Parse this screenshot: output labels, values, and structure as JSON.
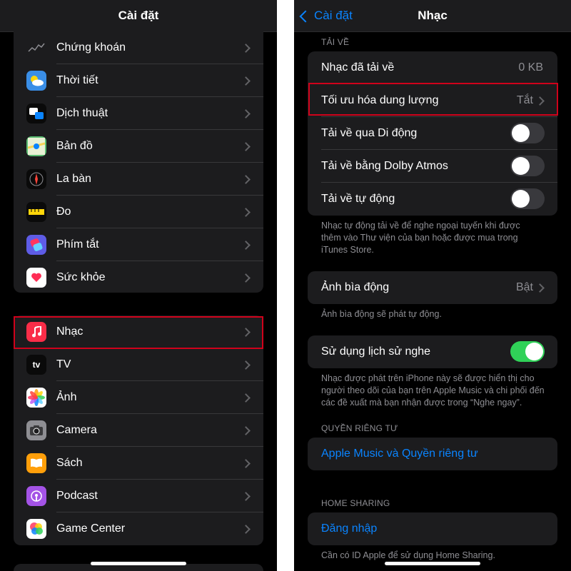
{
  "left": {
    "title": "Cài đặt",
    "group1": [
      {
        "label": "Chứng khoán",
        "icon": "stocks-icon",
        "color": "#1c1c1e"
      },
      {
        "label": "Thời tiết",
        "icon": "weather-icon",
        "color": "#3a8ee6"
      },
      {
        "label": "Dịch thuật",
        "icon": "translate-icon",
        "color": "#0a0a0a"
      },
      {
        "label": "Bản đồ",
        "icon": "maps-icon",
        "color": "#5bbd72"
      },
      {
        "label": "La bàn",
        "icon": "compass-icon",
        "color": "#0a0a0a"
      },
      {
        "label": "Đo",
        "icon": "measure-icon",
        "color": "#0a0a0a"
      },
      {
        "label": "Phím tắt",
        "icon": "shortcuts-icon",
        "color": "#5e5ce6"
      },
      {
        "label": "Sức khỏe",
        "icon": "health-icon",
        "color": "#ffffff"
      }
    ],
    "group2": [
      {
        "label": "Nhạc",
        "icon": "music-icon",
        "color": "#fa2d48"
      },
      {
        "label": "TV",
        "icon": "tv-icon",
        "color": "#0a0a0a",
        "icon_text": "tv"
      },
      {
        "label": "Ảnh",
        "icon": "photos-icon",
        "color": "#ffffff"
      },
      {
        "label": "Camera",
        "icon": "camera-icon",
        "color": "#8e8e93"
      },
      {
        "label": "Sách",
        "icon": "books-icon",
        "color": "#ff9f0a"
      },
      {
        "label": "Podcast",
        "icon": "podcast-icon",
        "color": "#a453e6"
      },
      {
        "label": "Game Center",
        "icon": "game-center-icon",
        "color": "#ffffff"
      }
    ]
  },
  "right": {
    "back_label": "Cài đặt",
    "title": "Nhạc",
    "downloads": {
      "header": "TẢI VỀ",
      "downloaded_label": "Nhạc đã tải về",
      "downloaded_value": "0 KB",
      "optimize_label": "Tối ưu hóa dung lượng",
      "optimize_value": "Tắt",
      "cellular_label": "Tải về qua Di động",
      "cellular_on": false,
      "dolby_label": "Tải về bằng Dolby Atmos",
      "dolby_on": false,
      "auto_label": "Tải về tự động",
      "auto_on": false,
      "footer": "Nhạc tự động tải về để nghe ngoại tuyến khi được thêm vào Thư viện của bạn hoặc được mua trong iTunes Store."
    },
    "animated_art": {
      "label": "Ảnh bìa động",
      "value": "Bật",
      "footer": "Ảnh bìa động sẽ phát tự động."
    },
    "history": {
      "label": "Sử dụng lịch sử nghe",
      "on": true,
      "footer": "Nhạc được phát trên iPhone này sẽ được hiển thị cho người theo dõi của bạn trên Apple Music và chi phối đến các đề xuất mà bạn nhận được trong “Nghe ngay”."
    },
    "privacy": {
      "header": "QUYỀN RIÊNG TƯ",
      "link": "Apple Music và Quyền riêng tư"
    },
    "home_sharing": {
      "header": "HOME SHARING",
      "link": "Đăng nhập",
      "footer": "Cần có ID Apple để sử dụng Home Sharing."
    }
  },
  "colors": {
    "accent": "#0a84ff",
    "toggle_on": "#30d158",
    "highlight": "#d0021b"
  }
}
